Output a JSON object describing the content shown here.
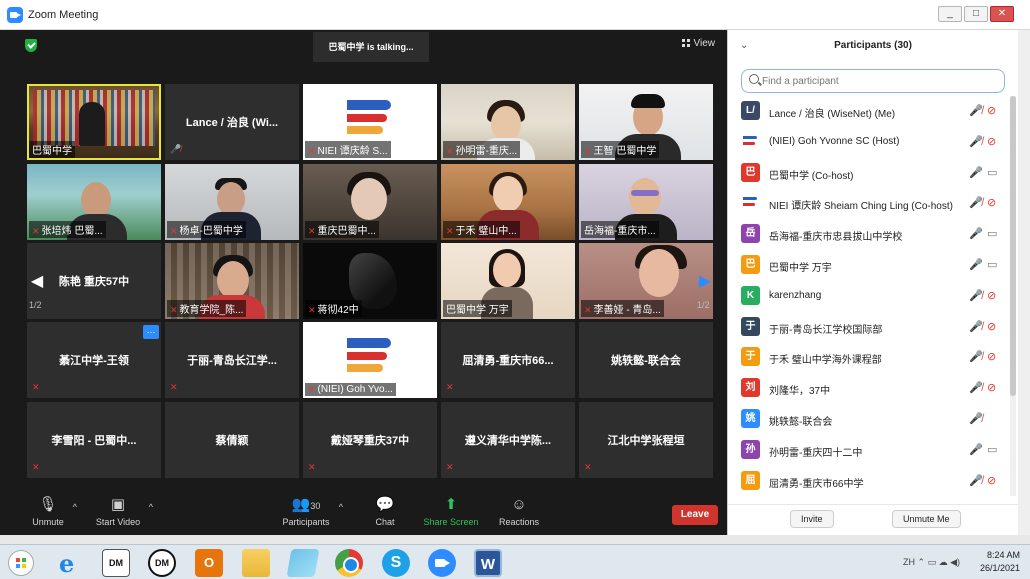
{
  "window": {
    "title": "Zoom Meeting",
    "buttons": [
      "_",
      "□",
      "✕"
    ]
  },
  "meeting": {
    "talking_banner": "巴蜀中学 is  talking...",
    "view_label": "View",
    "page_left": "1/2",
    "page_right": "1/2",
    "tiles": [
      {
        "label": "巴蜀中学"
      },
      {
        "label": "Lance / 治良 (Wi..."
      },
      {
        "label": "NIEI 谭庆龄 S..."
      },
      {
        "label": "孙明雷-重庆..."
      },
      {
        "label": "王智 巴蜀中学"
      },
      {
        "label": "张培炜 巴蜀..."
      },
      {
        "label": "杨卓-巴蜀中学"
      },
      {
        "label": "重庆巴蜀中..."
      },
      {
        "label": "于禾 璧山中..."
      },
      {
        "label": "岳海福-重庆市..."
      },
      {
        "label": "陈艳  重庆57中"
      },
      {
        "label": "教育学院_陈..."
      },
      {
        "label": "蒋彻42中"
      },
      {
        "label": "巴蜀中学 万宇"
      },
      {
        "label": "李善娅 - 青岛..."
      },
      {
        "label": "綦江中学-王领"
      },
      {
        "label": "于丽-青岛长江学..."
      },
      {
        "label": "(NIEI) Goh Yvo..."
      },
      {
        "label": "屈清勇-重庆市66..."
      },
      {
        "label": "姚轶懿-联合会"
      },
      {
        "label": "李雪阳 - 巴蜀中..."
      },
      {
        "label": "蔡倩颖"
      },
      {
        "label": "戴娅琴重庆37中"
      },
      {
        "label": "遵义清华中学陈..."
      },
      {
        "label": "江北中学张程垣"
      }
    ]
  },
  "toolbar": {
    "unmute": "Unmute",
    "start_video": "Start Video",
    "participants": "Participants",
    "participants_count": "30",
    "chat": "Chat",
    "share_screen": "Share Screen",
    "reactions": "Reactions",
    "leave": "Leave"
  },
  "panel": {
    "title": "Participants (30)",
    "search_placeholder": "Find a participant",
    "participants": [
      {
        "avatar": "L/",
        "color": "#3a4a66",
        "name": "Lance / 治良 (WiseNet) (Me)"
      },
      {
        "avatar": "",
        "color": "#ffffff",
        "name": "(NIEI) Goh Yvonne SC (Host)"
      },
      {
        "avatar": "巴",
        "color": "#e0382c",
        "name": "巴蜀中学 (Co-host)"
      },
      {
        "avatar": "",
        "color": "#ffffff",
        "name": "NIEI 谭庆龄 Sheiam Ching Ling (Co-host)"
      },
      {
        "avatar": "岳",
        "color": "#8e44ad",
        "name": "岳海福-重庆市忠县拔山中学校"
      },
      {
        "avatar": "巴",
        "color": "#f39c12",
        "name": "巴蜀中学 万宇"
      },
      {
        "avatar": "K",
        "color": "#27ae60",
        "name": "karenzhang"
      },
      {
        "avatar": "于",
        "color": "#34495e",
        "name": "于丽-青岛长江学校国际部"
      },
      {
        "avatar": "于",
        "color": "#f39c12",
        "name": "于禾 璧山中学海外课程部"
      },
      {
        "avatar": "刘",
        "color": "#e0382c",
        "name": "刘隆华，37中"
      },
      {
        "avatar": "姚",
        "color": "#2d8cff",
        "name": "姚轶懿-联合会"
      },
      {
        "avatar": "孙",
        "color": "#8e44ad",
        "name": "孙明雷-重庆四十二中"
      },
      {
        "avatar": "屈",
        "color": "#f39c12",
        "name": "屈清勇-重庆市66中学"
      }
    ],
    "invite": "Invite",
    "unmute_me": "Unmute Me"
  },
  "taskbar": {
    "dm1": "DM",
    "dm2": "DM",
    "outlook": "O",
    "skype": "S",
    "word": "W",
    "lang": "ZH",
    "time": "8:24 AM",
    "date": "26/1/2021"
  }
}
